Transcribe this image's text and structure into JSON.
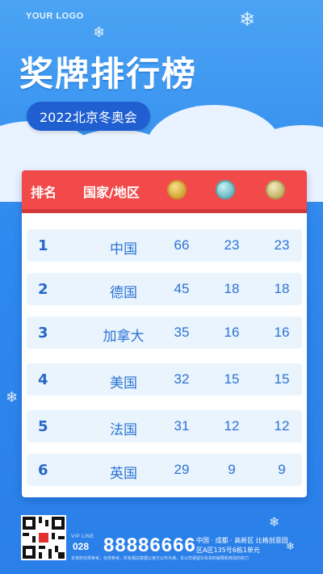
{
  "logo": "YOUR LOGO",
  "title": "奖牌排行榜",
  "subtitle": "2022北京冬奥会",
  "header": {
    "rank": "排名",
    "country": "国家/地区",
    "medal_icons": [
      "gold-medal-icon",
      "silver-medal-icon",
      "bronze-medal-icon"
    ]
  },
  "rows": [
    {
      "rank": "1",
      "country": "中国",
      "gold": "66",
      "silver": "23",
      "bronze": "23"
    },
    {
      "rank": "2",
      "country": "德国",
      "gold": "45",
      "silver": "18",
      "bronze": "18"
    },
    {
      "rank": "3",
      "country": "加拿大",
      "gold": "35",
      "silver": "16",
      "bronze": "16"
    },
    {
      "rank": "4",
      "country": "美国",
      "gold": "32",
      "silver": "15",
      "bronze": "15"
    },
    {
      "rank": "5",
      "country": "法国",
      "gold": "31",
      "silver": "12",
      "bronze": "12"
    },
    {
      "rank": "6",
      "country": "英国",
      "gold": "29",
      "silver": "9",
      "bronze": "9"
    }
  ],
  "footer": {
    "vip_line": "VIP LINE",
    "area_code": "028",
    "phone": "88886666",
    "address_line1": "中国 · 成都 · 高新区 比格创意园",
    "address_line2": "区A区135号6栋1单元",
    "note": "本资料仅供参考，仅供参考。所有相关数据以官方公布为准，本公司保留对本资料解释和修改的权力"
  },
  "colors": {
    "background": "#2f89ee",
    "header_red": "#f24a4a",
    "pill_blue": "#1f5fd1",
    "row_bg": "#eaf4fd",
    "text_blue": "#2c73d4"
  }
}
